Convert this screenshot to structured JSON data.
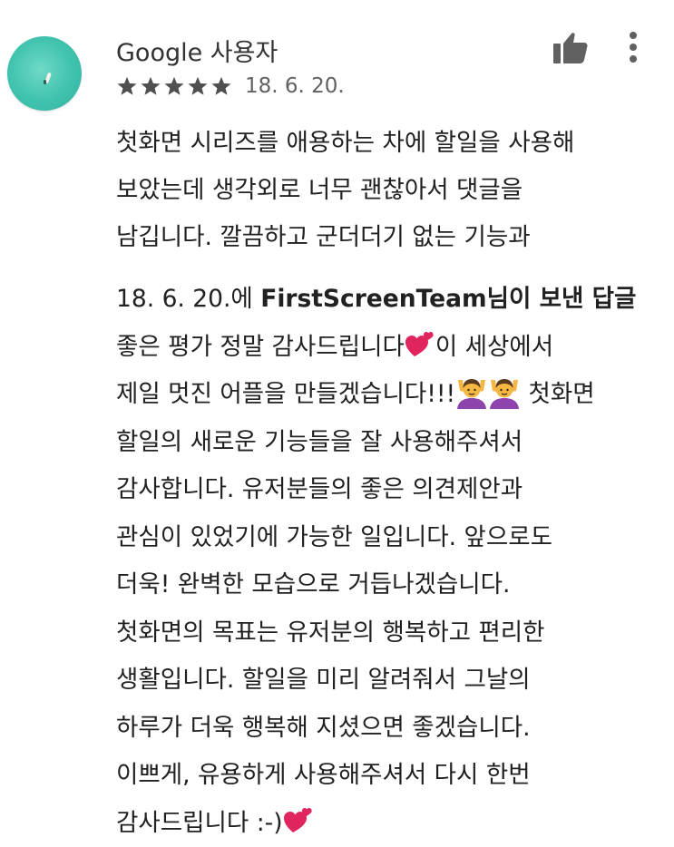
{
  "review": {
    "author": "Google 사용자",
    "rating": 5,
    "rating_max": 5,
    "date": "18. 6. 20.",
    "body_lines": [
      "첫화면 시리즈를 애용하는 차에 할일을 사용해",
      "보았는데 생각외로 너무 괜찮아서 댓글을",
      "남깁니다. 깔끔하고 군더더기 없는 기능과"
    ],
    "colors": {
      "star": "#505050",
      "text": "#212121",
      "meta": "#616161",
      "avatar": "#3fc2ae",
      "heart": "#e0245e"
    },
    "icons": {
      "thumb": "thumbs-up-icon",
      "more": "more-vert-icon"
    }
  },
  "reply": {
    "header_date": "18. 6. 20.에 ",
    "developer": "FirstScreenTeam",
    "header_suffix": "님이 보낸 답글",
    "lines": {
      "l1a": "좋은 평가 정말 감사드립니다",
      "l1b": "이 세상에서",
      "l2a": "제일 멋진 어플을 만들겠습니다!!!",
      "l2b": " 첫화면",
      "l3": "할일의 새로운 기능들을 잘 사용해주셔서",
      "l4": "감사합니다. 유저분들의 좋은 의견제안과",
      "l5": "관심이 있었기에 가능한 일입니다. 앞으로도",
      "l6": "더욱! 완벽한 모습으로 거듭나겠습니다.",
      "l7": "첫화면의 목표는 유저분의 행복하고 편리한",
      "l8": "생활입니다. 할일을 미리 알려줘서 그날의",
      "l9": "하루가 더욱 행복해 지셨으면 좋겠습니다.",
      "l10": "이쁘게, 유용하게 사용해주셔서 다시 한번",
      "l11": "감사드립니다 :-)"
    },
    "emojis": [
      "two-hearts-emoji",
      "person-gesturing-ok-emoji"
    ]
  }
}
